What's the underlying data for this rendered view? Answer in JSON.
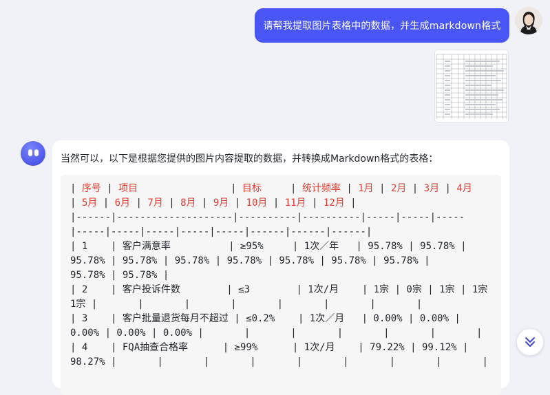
{
  "user_message": "请帮我提取图片表格中的数据，并生成markdown格式",
  "assistant_intro": "当然可以，以下是根据您提供的图片内容提取的数据，并转换成Markdown格式的表格：",
  "headers": [
    "序号",
    "项目",
    "目标",
    "统计频率",
    "1月",
    "2月",
    "3月",
    "4月",
    "5月",
    "6月",
    "7月",
    "8月",
    "9月",
    "10月",
    "11月",
    "12月"
  ],
  "code_lines": [
    "|------|--------------------|----------|----------|-----|-----|-----",
    "|-----|-----|-----|-----|-----|------|------|------|",
    "| 1    | 客户满意率          | ≥95%     | 1次／年   | 95.78% | 95.78% |",
    "95.78% | 95.78% | 95.78% | 95.78% | 95.78% | 95.78% | 95.78% |",
    "95.78% | 95.78% |",
    "| 2    | 客户投诉件数        | ≤3        | 1次/月    | 1宗 | 0宗 | 1宗 | 1宗",
    "1宗 |       |       |       |       |       |       |       |",
    "| 3    | 客户批量退货每月不超过 | ≤0.2%    | 1次／月   | 0.00% | 0.00% |",
    "0.00% | 0.00% | 0.00% |       |       |       |       |       |       |",
    "| 4    | FQA抽查合格率      | ≥99%      | 1次/月    | 79.22% | 99.12% |",
    "98.27% |       |       |       |       |       |       |       |       |"
  ],
  "colors": {
    "accent": "#4a55f5",
    "header_red": "#e03c31"
  },
  "icons": {
    "scroll": "chevron-double-down-icon"
  }
}
